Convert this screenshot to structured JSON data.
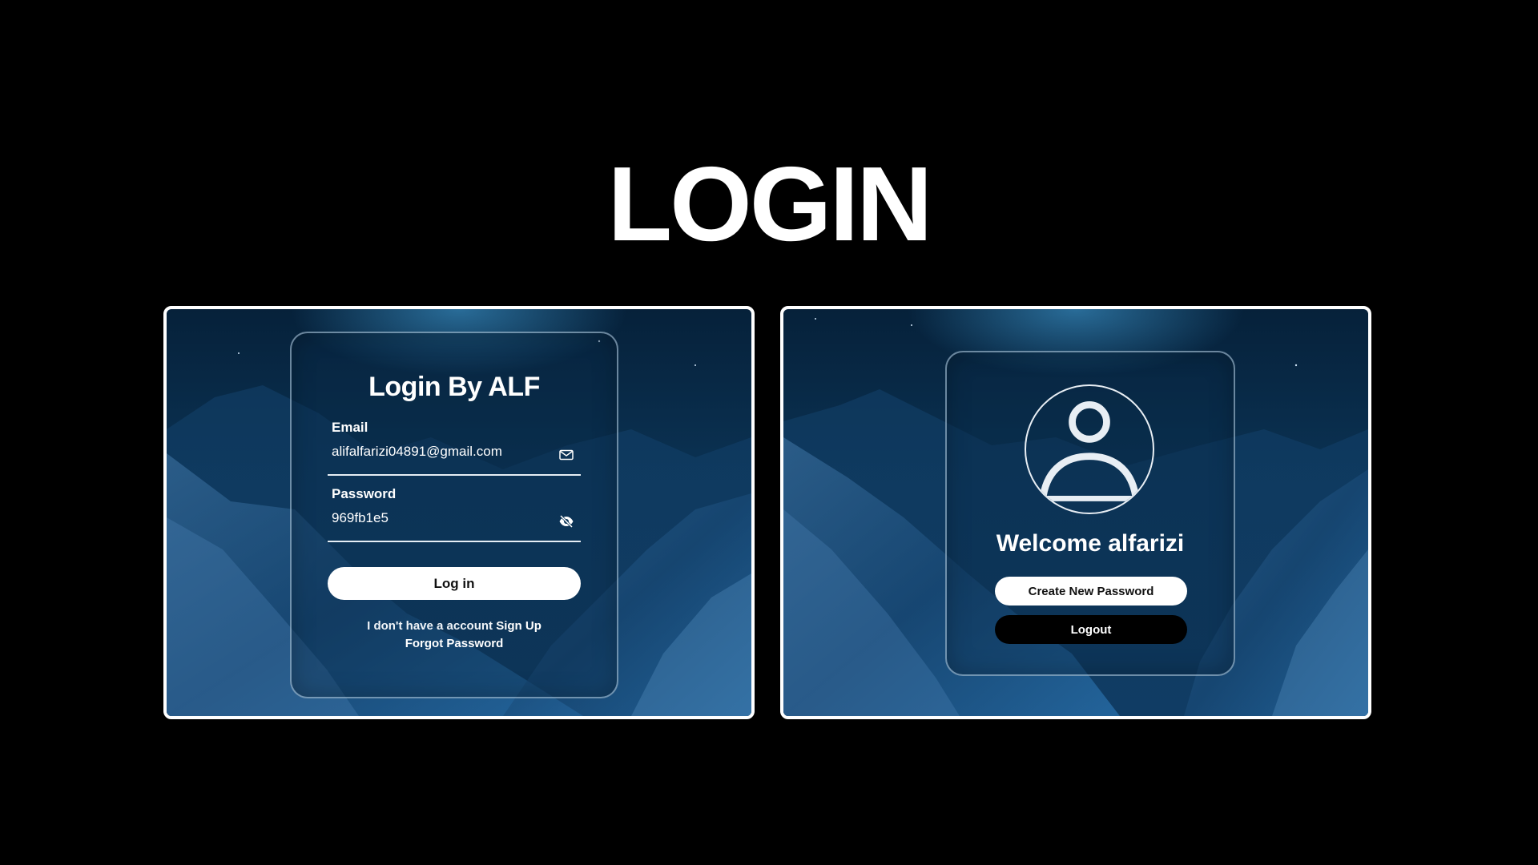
{
  "page": {
    "title": "LOGIN"
  },
  "login_screen": {
    "heading": "Login By ALF",
    "email": {
      "label": "Email",
      "value": "alifalfarizi04891@gmail.com",
      "icon": "mail-icon"
    },
    "password": {
      "label": "Password",
      "value": "969fb1e5",
      "icon": "eye-off-icon"
    },
    "login_button": "Log in",
    "signup_prompt": "I don't have a account",
    "signup_link": "Sign Up",
    "forgot_link": "Forgot Password"
  },
  "welcome_screen": {
    "avatar_icon": "user-icon",
    "heading": "Welcome alfarizi",
    "create_password_button": "Create New Password",
    "logout_button": "Logout"
  },
  "colors": {
    "background": "#000000",
    "panel_blue": "#0b3456",
    "button_light": "#ffffff",
    "button_dark": "#000000"
  }
}
